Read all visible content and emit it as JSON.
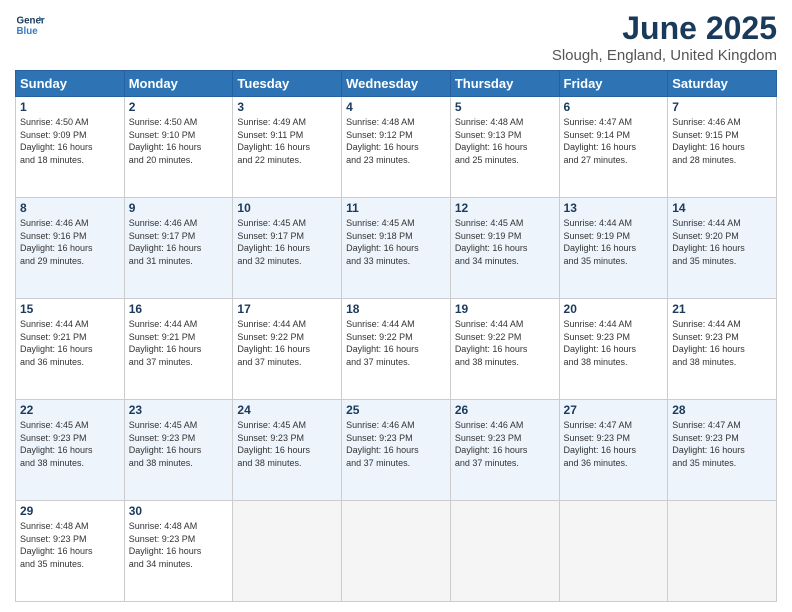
{
  "logo": {
    "line1": "General",
    "line2": "Blue"
  },
  "title": "June 2025",
  "subtitle": "Slough, England, United Kingdom",
  "days_of_week": [
    "Sunday",
    "Monday",
    "Tuesday",
    "Wednesday",
    "Thursday",
    "Friday",
    "Saturday"
  ],
  "weeks": [
    [
      {
        "num": "1",
        "info": "Sunrise: 4:50 AM\nSunset: 9:09 PM\nDaylight: 16 hours\nand 18 minutes."
      },
      {
        "num": "2",
        "info": "Sunrise: 4:50 AM\nSunset: 9:10 PM\nDaylight: 16 hours\nand 20 minutes."
      },
      {
        "num": "3",
        "info": "Sunrise: 4:49 AM\nSunset: 9:11 PM\nDaylight: 16 hours\nand 22 minutes."
      },
      {
        "num": "4",
        "info": "Sunrise: 4:48 AM\nSunset: 9:12 PM\nDaylight: 16 hours\nand 23 minutes."
      },
      {
        "num": "5",
        "info": "Sunrise: 4:48 AM\nSunset: 9:13 PM\nDaylight: 16 hours\nand 25 minutes."
      },
      {
        "num": "6",
        "info": "Sunrise: 4:47 AM\nSunset: 9:14 PM\nDaylight: 16 hours\nand 27 minutes."
      },
      {
        "num": "7",
        "info": "Sunrise: 4:46 AM\nSunset: 9:15 PM\nDaylight: 16 hours\nand 28 minutes."
      }
    ],
    [
      {
        "num": "8",
        "info": "Sunrise: 4:46 AM\nSunset: 9:16 PM\nDaylight: 16 hours\nand 29 minutes."
      },
      {
        "num": "9",
        "info": "Sunrise: 4:46 AM\nSunset: 9:17 PM\nDaylight: 16 hours\nand 31 minutes."
      },
      {
        "num": "10",
        "info": "Sunrise: 4:45 AM\nSunset: 9:17 PM\nDaylight: 16 hours\nand 32 minutes."
      },
      {
        "num": "11",
        "info": "Sunrise: 4:45 AM\nSunset: 9:18 PM\nDaylight: 16 hours\nand 33 minutes."
      },
      {
        "num": "12",
        "info": "Sunrise: 4:45 AM\nSunset: 9:19 PM\nDaylight: 16 hours\nand 34 minutes."
      },
      {
        "num": "13",
        "info": "Sunrise: 4:44 AM\nSunset: 9:19 PM\nDaylight: 16 hours\nand 35 minutes."
      },
      {
        "num": "14",
        "info": "Sunrise: 4:44 AM\nSunset: 9:20 PM\nDaylight: 16 hours\nand 35 minutes."
      }
    ],
    [
      {
        "num": "15",
        "info": "Sunrise: 4:44 AM\nSunset: 9:21 PM\nDaylight: 16 hours\nand 36 minutes."
      },
      {
        "num": "16",
        "info": "Sunrise: 4:44 AM\nSunset: 9:21 PM\nDaylight: 16 hours\nand 37 minutes."
      },
      {
        "num": "17",
        "info": "Sunrise: 4:44 AM\nSunset: 9:22 PM\nDaylight: 16 hours\nand 37 minutes."
      },
      {
        "num": "18",
        "info": "Sunrise: 4:44 AM\nSunset: 9:22 PM\nDaylight: 16 hours\nand 37 minutes."
      },
      {
        "num": "19",
        "info": "Sunrise: 4:44 AM\nSunset: 9:22 PM\nDaylight: 16 hours\nand 38 minutes."
      },
      {
        "num": "20",
        "info": "Sunrise: 4:44 AM\nSunset: 9:23 PM\nDaylight: 16 hours\nand 38 minutes."
      },
      {
        "num": "21",
        "info": "Sunrise: 4:44 AM\nSunset: 9:23 PM\nDaylight: 16 hours\nand 38 minutes."
      }
    ],
    [
      {
        "num": "22",
        "info": "Sunrise: 4:45 AM\nSunset: 9:23 PM\nDaylight: 16 hours\nand 38 minutes."
      },
      {
        "num": "23",
        "info": "Sunrise: 4:45 AM\nSunset: 9:23 PM\nDaylight: 16 hours\nand 38 minutes."
      },
      {
        "num": "24",
        "info": "Sunrise: 4:45 AM\nSunset: 9:23 PM\nDaylight: 16 hours\nand 38 minutes."
      },
      {
        "num": "25",
        "info": "Sunrise: 4:46 AM\nSunset: 9:23 PM\nDaylight: 16 hours\nand 37 minutes."
      },
      {
        "num": "26",
        "info": "Sunrise: 4:46 AM\nSunset: 9:23 PM\nDaylight: 16 hours\nand 37 minutes."
      },
      {
        "num": "27",
        "info": "Sunrise: 4:47 AM\nSunset: 9:23 PM\nDaylight: 16 hours\nand 36 minutes."
      },
      {
        "num": "28",
        "info": "Sunrise: 4:47 AM\nSunset: 9:23 PM\nDaylight: 16 hours\nand 35 minutes."
      }
    ],
    [
      {
        "num": "29",
        "info": "Sunrise: 4:48 AM\nSunset: 9:23 PM\nDaylight: 16 hours\nand 35 minutes."
      },
      {
        "num": "30",
        "info": "Sunrise: 4:48 AM\nSunset: 9:23 PM\nDaylight: 16 hours\nand 34 minutes."
      },
      {
        "num": "",
        "info": ""
      },
      {
        "num": "",
        "info": ""
      },
      {
        "num": "",
        "info": ""
      },
      {
        "num": "",
        "info": ""
      },
      {
        "num": "",
        "info": ""
      }
    ]
  ]
}
